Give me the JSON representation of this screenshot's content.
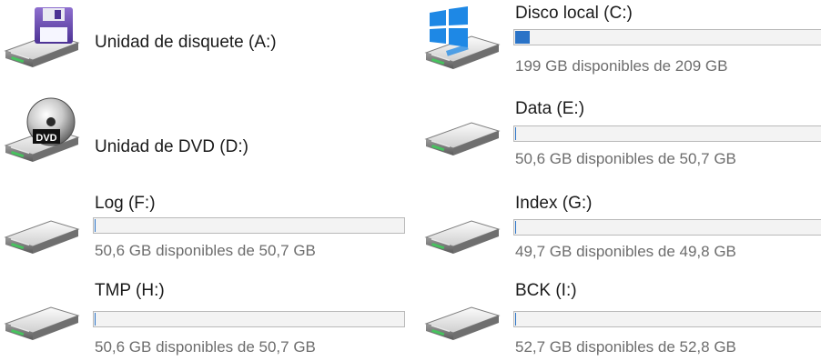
{
  "drives": [
    {
      "id": "A",
      "name": "Unidad de disquete (A:)",
      "icon": "floppy-drive-icon"
    },
    {
      "id": "D",
      "name": "Unidad de DVD (D:)",
      "icon": "dvd-drive-icon",
      "icon_text": "DVD"
    },
    {
      "id": "F",
      "name": "Log (F:)",
      "icon": "hard-drive-icon",
      "free_text": "50,6 GB disponibles de 50,7 GB",
      "used_fraction": 0.002
    },
    {
      "id": "H",
      "name": "TMP (H:)",
      "icon": "hard-drive-icon",
      "free_text": "50,6 GB disponibles de 50,7 GB",
      "used_fraction": 0.002
    },
    {
      "id": "C",
      "name": "Disco local (C:)",
      "icon": "windows-system-drive-icon",
      "free_text": "199 GB disponibles de 209 GB",
      "used_fraction": 0.048
    },
    {
      "id": "E",
      "name": "Data (E:)",
      "icon": "hard-drive-icon",
      "free_text": "50,6 GB disponibles de 50,7 GB",
      "used_fraction": 0.002
    },
    {
      "id": "G",
      "name": "Index (G:)",
      "icon": "hard-drive-icon",
      "free_text": "49,7 GB disponibles de 49,8 GB",
      "used_fraction": 0.002
    },
    {
      "id": "I",
      "name": "BCK (I:)",
      "icon": "hard-drive-icon",
      "free_text": "52,7 GB disponibles de 52,8 GB",
      "used_fraction": 0.002
    }
  ],
  "colors": {
    "usage_bar_fill": "#2a73c7",
    "windows_logo": "#1e88e5"
  }
}
